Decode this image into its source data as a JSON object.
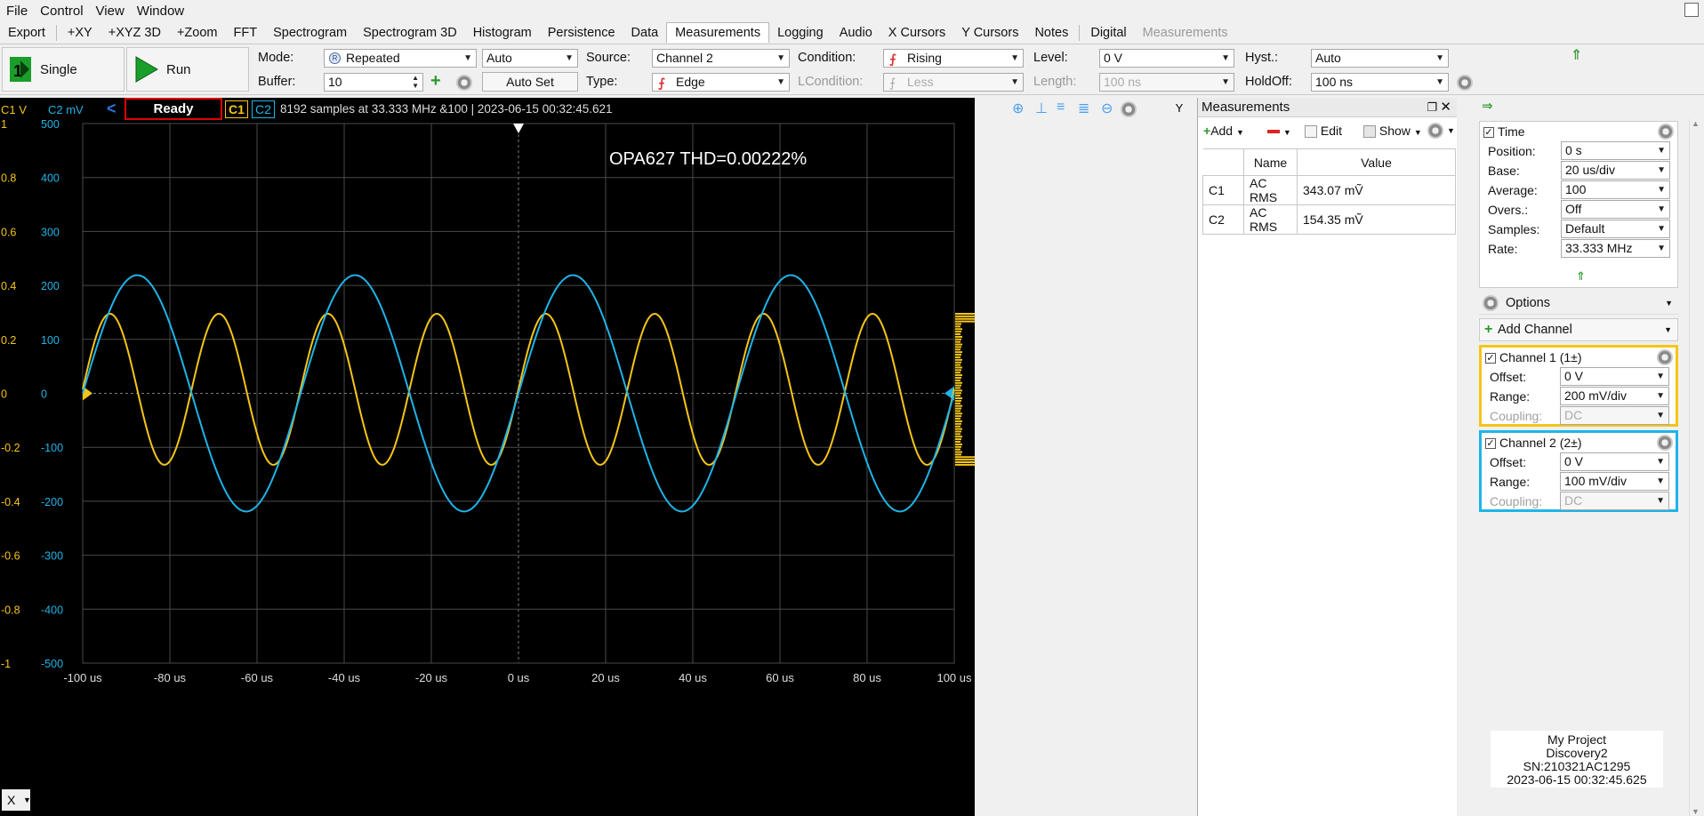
{
  "menu": [
    "File",
    "Control",
    "View",
    "Window"
  ],
  "tabs": [
    "Export",
    "+XY",
    "+XYZ 3D",
    "+Zoom",
    "FFT",
    "Spectrogram",
    "Spectrogram 3D",
    "Histogram",
    "Persistence",
    "Data",
    "Measurements",
    "Logging",
    "Audio",
    "X Cursors",
    "Y Cursors",
    "Notes",
    "Digital",
    "Measurements"
  ],
  "active_tab_index": 10,
  "toolbar": {
    "single_label": "Single",
    "run_label": "Run",
    "mode_label": "Mode:",
    "mode_value": "Repeated",
    "mode_aux": "Auto",
    "buffer_label": "Buffer:",
    "buffer_value": "10",
    "autoset_label": "Auto Set",
    "source_label": "Source:",
    "source_value": "Channel 2",
    "type_label": "Type:",
    "type_value": "Edge",
    "condition_label": "Condition:",
    "condition_value": "Rising",
    "lcondition_label": "LCondition:",
    "lcondition_value": "Less",
    "level_label": "Level:",
    "level_value": "0 V",
    "length_label": "Length:",
    "length_value": "100 ns",
    "hyst_label": "Hyst.:",
    "hyst_value": "Auto",
    "holdoff_label": "HoldOff:",
    "holdoff_value": "100 ns"
  },
  "plot": {
    "c1_unit": "C1 V",
    "c2_unit": "C2 mV",
    "status": "Ready",
    "c1_tag": "C1",
    "c2_tag": "C2",
    "acq_info": "8192 samples at 33.333 MHz &100 | 2023-06-15 00:32:45.621",
    "y_button": "Y",
    "x_button": "X",
    "annotation": "OPA627 THD=0.00222%"
  },
  "chart_data": {
    "type": "line",
    "title": "OPA627 THD=0.00222%",
    "xlabel": "",
    "x_ticks": [
      "-100 us",
      "-80 us",
      "-60 us",
      "-40 us",
      "-20 us",
      "0 us",
      "20 us",
      "40 us",
      "60 us",
      "80 us",
      "100 us"
    ],
    "xlim": [
      -100,
      100
    ],
    "y1_ticks": [
      "1",
      "0.8",
      "0.6",
      "0.4",
      "0.2",
      "0",
      "-0.2",
      "-0.4",
      "-0.6",
      "-0.8",
      "-1"
    ],
    "y1lim": [
      -1,
      1
    ],
    "y2_ticks": [
      "500",
      "400",
      "300",
      "200",
      "100",
      "0",
      "-100",
      "-200",
      "-300",
      "-400",
      "-500"
    ],
    "y2lim": [
      -500,
      500
    ],
    "grid": true,
    "series": [
      {
        "name": "C1",
        "color": "#f5c518",
        "axis": "y1",
        "amplitude": 0.28,
        "offset": 0.015,
        "period_us": 25,
        "phase_zero_us": -100
      },
      {
        "name": "C2",
        "color": "#1fb4e8",
        "axis": "y2",
        "amplitude": 219,
        "offset": 0,
        "period_us": 50,
        "phase_zero_us": 0
      }
    ]
  },
  "measurements": {
    "title": "Measurements",
    "add_label": "Add",
    "edit_label": "Edit",
    "show_label": "Show",
    "col_name": "Name",
    "col_value": "Value",
    "rows": [
      {
        "ch": "C1",
        "name": "AC RMS",
        "value": "343.07 mṼ"
      },
      {
        "ch": "C2",
        "name": "AC RMS",
        "value": "154.35 mṼ"
      }
    ]
  },
  "time": {
    "title": "Time",
    "position_label": "Position:",
    "position_value": "0 s",
    "base_label": "Base:",
    "base_value": "20 us/div",
    "average_label": "Average:",
    "average_value": "100",
    "overs_label": "Overs.:",
    "overs_value": "Off",
    "samples_label": "Samples:",
    "samples_value": "Default",
    "rate_label": "Rate:",
    "rate_value": "33.333 MHz"
  },
  "options_label": "Options",
  "add_channel_label": "Add Channel",
  "channel1": {
    "title": "Channel 1 (1±)",
    "color": "#f5c518",
    "offset_label": "Offset:",
    "offset_value": "0 V",
    "range_label": "Range:",
    "range_value": "200 mV/div",
    "coupling_label": "Coupling:",
    "coupling_value": "DC"
  },
  "channel2": {
    "title": "Channel 2 (2±)",
    "color": "#1fb4e8",
    "offset_label": "Offset:",
    "offset_value": "0 V",
    "range_label": "Range:",
    "range_value": "100 mV/div",
    "coupling_label": "Coupling:",
    "coupling_value": "DC"
  },
  "device": {
    "project": "My Project",
    "model": "Discovery2",
    "serial": "SN:210321AC1295",
    "timestamp": "2023-06-15 00:32:45.625"
  }
}
